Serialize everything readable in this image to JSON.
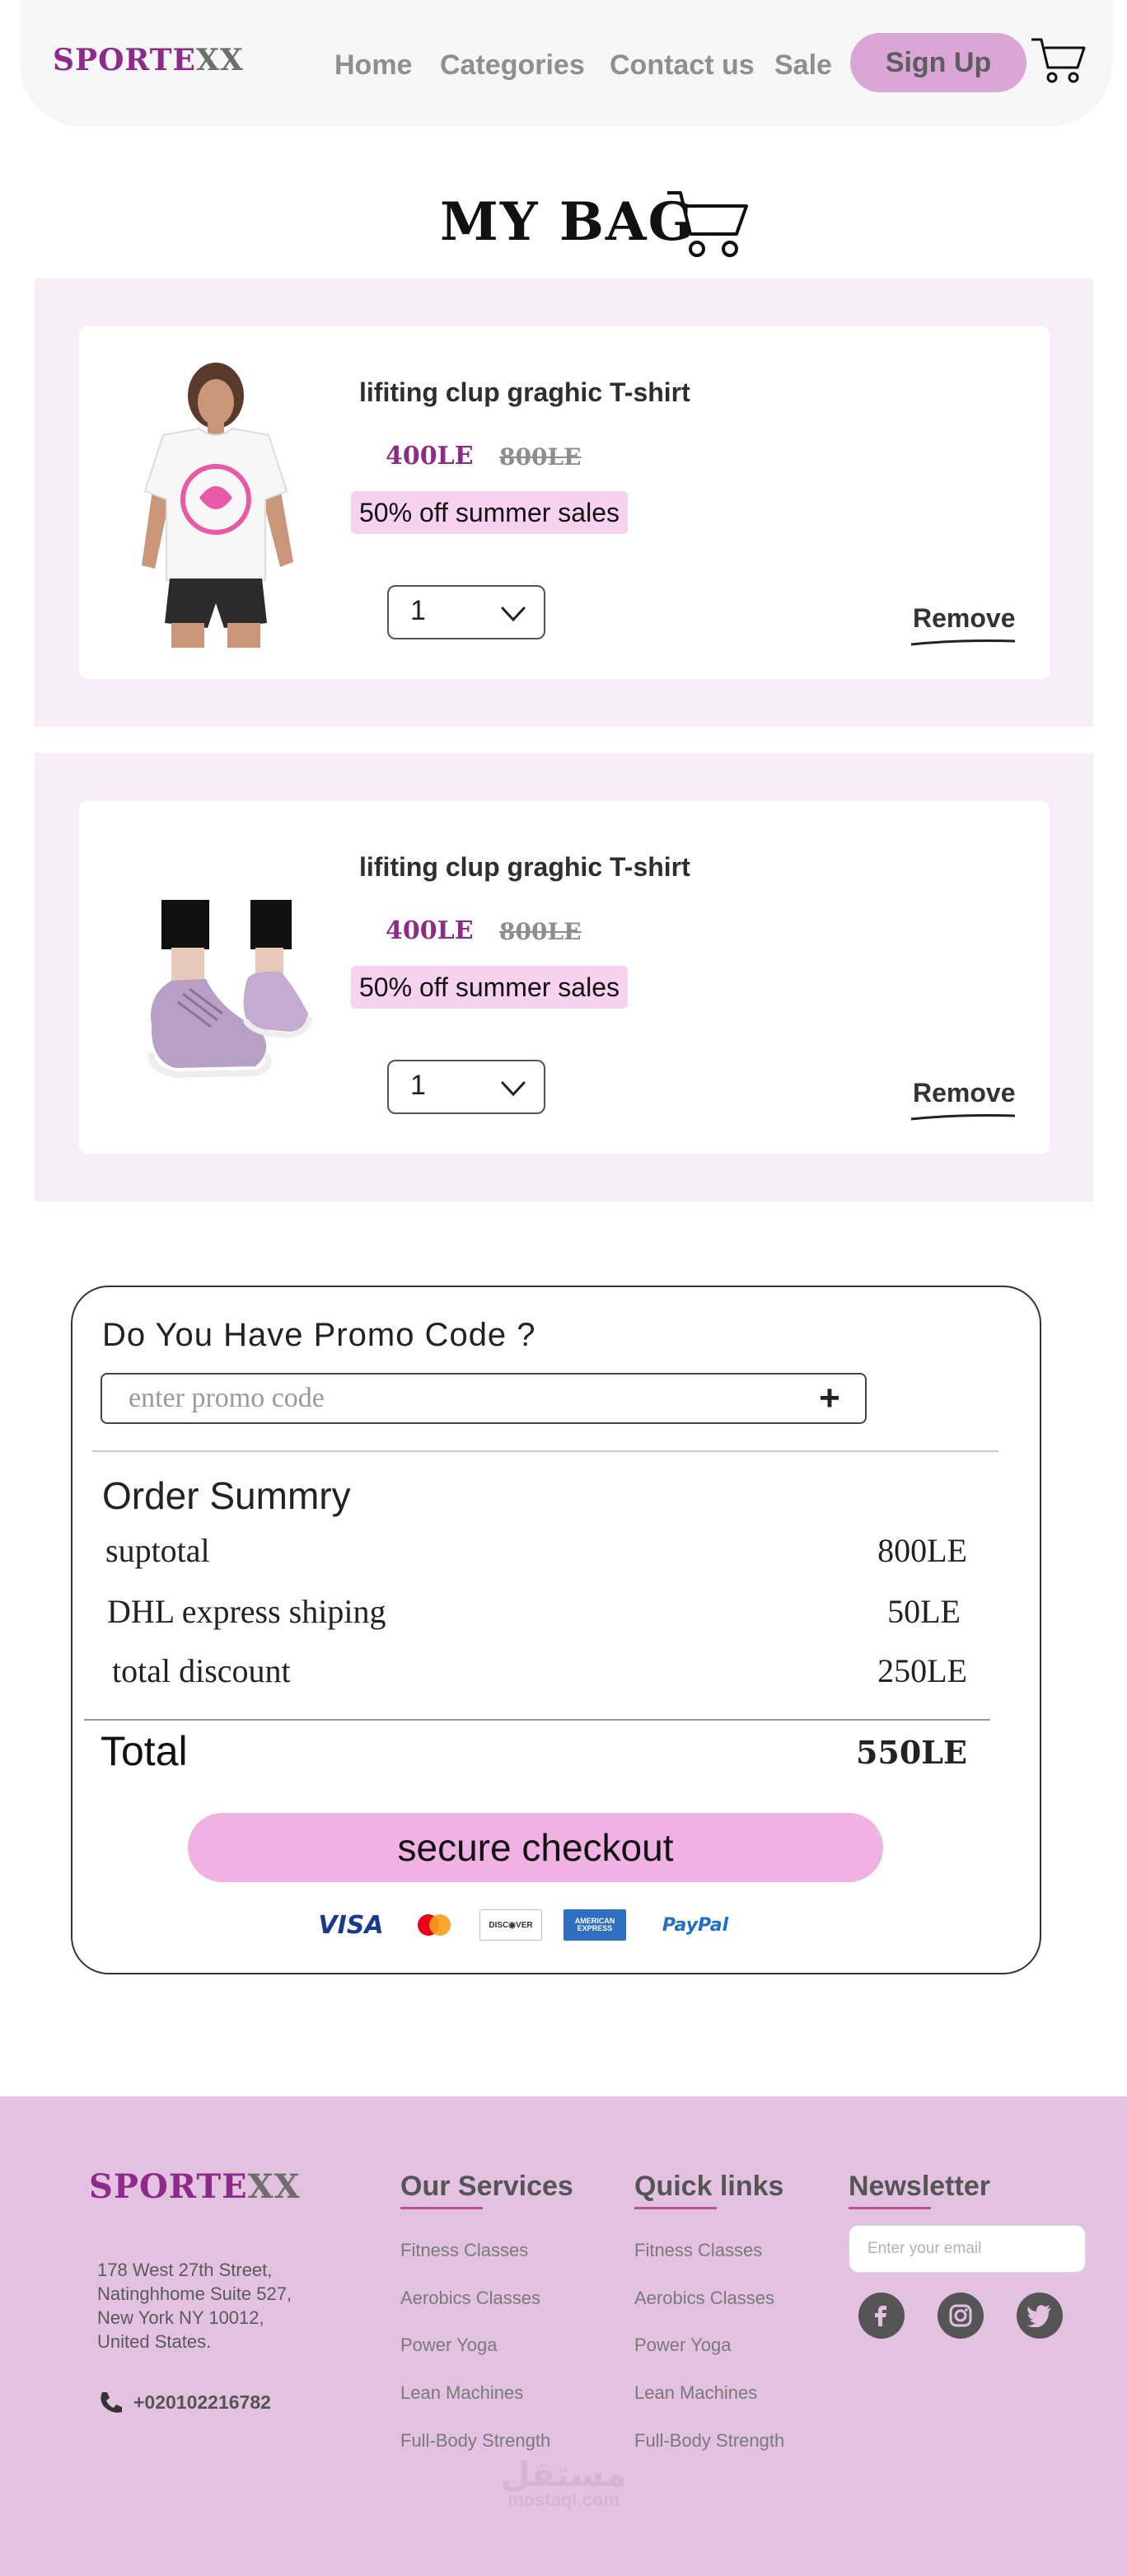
{
  "brand": {
    "part1": "SPORTE",
    "part2": "XX"
  },
  "nav": {
    "links": [
      "Home",
      "Categories",
      "Contact us",
      "Sale"
    ],
    "signup_label": "Sign Up"
  },
  "page_title": "MY BAG",
  "items": [
    {
      "name": "lifiting clup graghic T-shirt",
      "price": "400LE",
      "old_price": "800LE",
      "promo": "50% off summer sales",
      "quantity": "1",
      "remove_label": "Remove",
      "image": "white-graphic-tshirt"
    },
    {
      "name": "lifiting clup graghic T-shirt",
      "price": "400LE",
      "old_price": "800LE",
      "promo": "50% off summer sales",
      "quantity": "1",
      "remove_label": "Remove",
      "image": "lilac-sneakers"
    }
  ],
  "promo_section": {
    "question": "Do You Have Promo Code ?",
    "placeholder": "enter promo code",
    "add_symbol": "+"
  },
  "summary": {
    "heading": "Order Summry",
    "rows": [
      {
        "label": "suptotal",
        "value": "800LE"
      },
      {
        "label": "DHL express shiping",
        "value": "50LE"
      },
      {
        "label": "total discount",
        "value": "250LE"
      }
    ],
    "total_label": "Total",
    "total_value": "550LE",
    "checkout_label": "secure checkout",
    "payment_methods": [
      {
        "id": "visa",
        "label": "VISA"
      },
      {
        "id": "mastercard",
        "label": ""
      },
      {
        "id": "discover",
        "label": "DISC◉VER"
      },
      {
        "id": "amex",
        "label": "AMERICAN EXPRESS"
      },
      {
        "id": "paypal",
        "label": "PayPal"
      }
    ]
  },
  "footer": {
    "address": "178 West 27th Street,\nNatinghhome Suite 527,\n New York NY 10012,\nUnited States.",
    "phone": "+020102216782",
    "services_title": "Our Services",
    "services": [
      "Fitness Classes",
      "Aerobics Classes",
      "Power Yoga",
      "Lean Machines",
      "Full-Body Strength"
    ],
    "quick_title": "Quick links",
    "quick_links": [
      "Fitness Classes",
      "Aerobics Classes",
      "Power Yoga",
      "Lean Machines",
      "Full-Body Strength"
    ],
    "newsletter_title": "Newsletter",
    "newsletter_placeholder": "Enter your email",
    "social": [
      "facebook-icon",
      "instagram-icon",
      "twitter-icon"
    ],
    "watermark_arabic": "مستقل",
    "watermark_latin": "mostaql.com"
  },
  "colors": {
    "brand_purple": "#8e2a8a",
    "accent_pink": "#f0b2e3",
    "signup_bg": "#d9a6d6",
    "footer_bg": "#e3c1e0",
    "item_band": "#f7eef7"
  }
}
